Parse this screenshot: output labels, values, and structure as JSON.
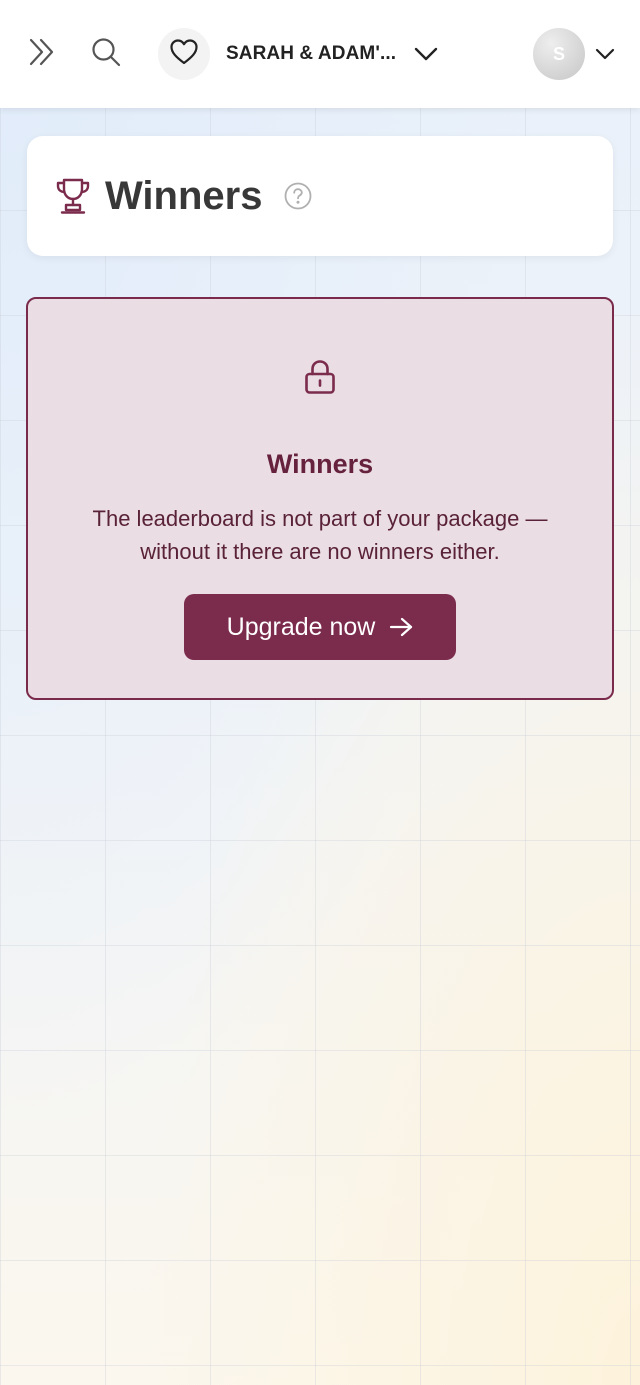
{
  "header": {
    "event_name": "SARAH & ADAM'...",
    "avatar_initial": "S",
    "icons": {
      "expand": "double-chevron-right-icon",
      "search": "search-icon",
      "event": "heart-icon",
      "event_dropdown": "chevron-down-icon",
      "profile_dropdown": "chevron-down-icon"
    }
  },
  "title_card": {
    "title": "Winners",
    "icon": "trophy-icon",
    "help_icon": "question-circle-icon"
  },
  "locked_card": {
    "icon": "lock-icon",
    "title": "Winners",
    "description": "The leaderboard is not part of your package — without it there are no winners either.",
    "button_label": "Upgrade now",
    "button_icon": "arrow-right-icon"
  },
  "colors": {
    "accent": "#7b2b4c",
    "locked_card_bg": "#eadde3",
    "title_text": "#383838"
  }
}
